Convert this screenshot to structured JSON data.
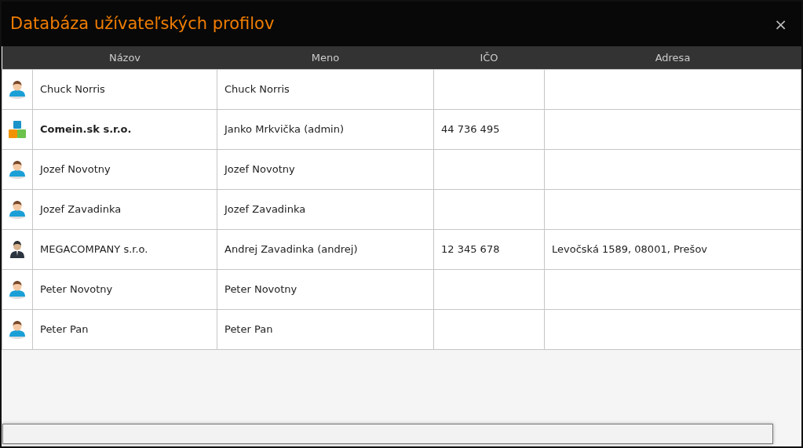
{
  "window": {
    "title": "Databáza užívateľských profilov",
    "close": "×"
  },
  "table": {
    "columns": [
      "Názov",
      "Meno",
      "IČO",
      "Adresa"
    ],
    "rows": [
      {
        "kind": "person",
        "name": "Chuck Norris",
        "bold": false,
        "meno": "Chuck Norris",
        "ico": "",
        "adresa": ""
      },
      {
        "kind": "company",
        "name": "Comein.sk s.r.o.",
        "bold": true,
        "meno": "Janko Mrkvička (admin)",
        "ico": "44 736 495",
        "adresa": ""
      },
      {
        "kind": "person",
        "name": "Jozef Novotny",
        "bold": false,
        "meno": "Jozef Novotny",
        "ico": "",
        "adresa": ""
      },
      {
        "kind": "person",
        "name": "Jozef Zavadinka",
        "bold": false,
        "meno": "Jozef Zavadinka",
        "ico": "",
        "adresa": ""
      },
      {
        "kind": "agent",
        "name": "MEGACOMPANY s.r.o.",
        "bold": false,
        "meno": "Andrej Zavadinka (andrej)",
        "ico": "12 345 678",
        "adresa": "Levočská 1589, 08001, Prešov"
      },
      {
        "kind": "person",
        "name": "Peter Novotny",
        "bold": false,
        "meno": "Peter Novotny",
        "ico": "",
        "adresa": ""
      },
      {
        "kind": "person",
        "name": "Peter Pan",
        "bold": false,
        "meno": "Peter Pan",
        "ico": "",
        "adresa": ""
      }
    ]
  }
}
